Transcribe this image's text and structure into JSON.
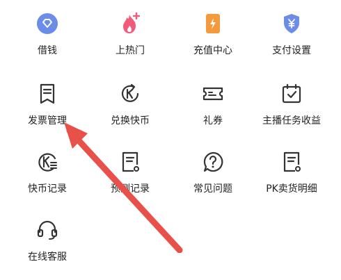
{
  "colors": {
    "arrow": "#E8504A",
    "icon_stroke": "#333333",
    "blue": "#6B8CE8",
    "orange": "#F39A3C",
    "pink": "#F25A7A"
  },
  "grid": {
    "items": [
      {
        "label": "借钱",
        "icon": "diamond-coin-icon"
      },
      {
        "label": "上热门",
        "icon": "flame-plus-icon"
      },
      {
        "label": "充值中心",
        "icon": "lightning-card-icon"
      },
      {
        "label": "支付设置",
        "icon": "shield-yen-icon"
      },
      {
        "label": "发票管理",
        "icon": "bookmark-list-icon"
      },
      {
        "label": "兑换快币",
        "icon": "k-coin-exchange-icon"
      },
      {
        "label": "礼券",
        "icon": "ticket-icon"
      },
      {
        "label": "主播任务收益",
        "icon": "calendar-check-icon"
      },
      {
        "label": "快币记录",
        "icon": "k-coin-list-icon"
      },
      {
        "label": "预测记录",
        "icon": "document-record-icon"
      },
      {
        "label": "常见问题",
        "icon": "question-bubble-icon"
      },
      {
        "label": "PK卖货明细",
        "icon": "document-detail-icon"
      },
      {
        "label": "在线客服",
        "icon": "headset-icon"
      }
    ]
  }
}
